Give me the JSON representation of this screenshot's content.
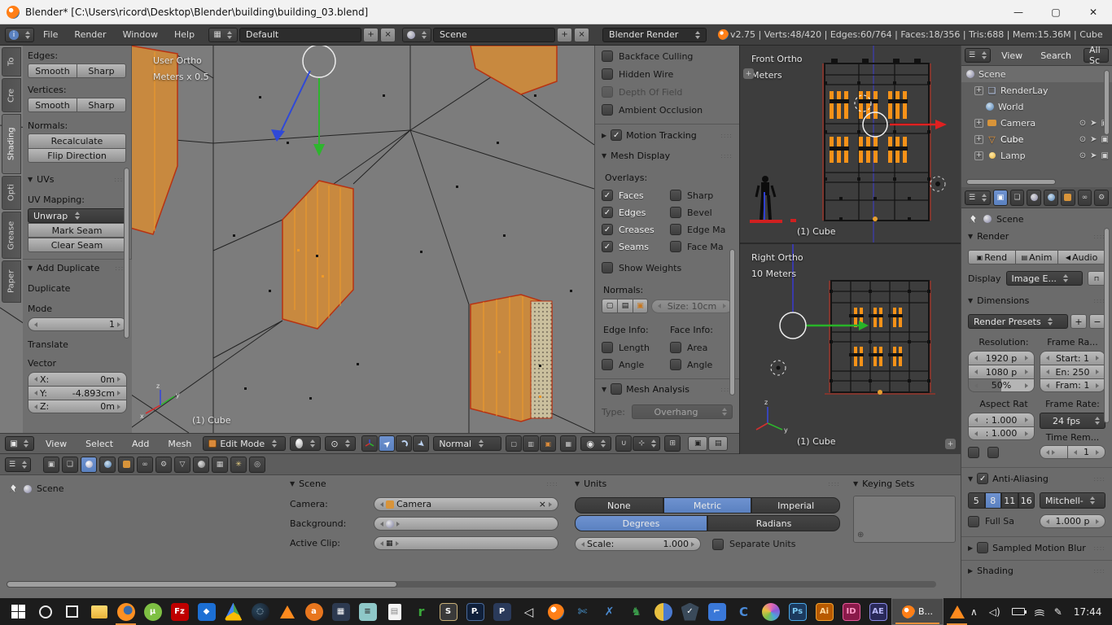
{
  "window": {
    "title": "Blender* [C:\\Users\\ricord\\Desktop\\Blender\\building\\building_03.blend]",
    "minimize": "—",
    "maximize": "▢",
    "close": "✕"
  },
  "infobar": {
    "menus": [
      "File",
      "Render",
      "Window",
      "Help"
    ],
    "layout": "Default",
    "scene": "Scene",
    "engine": "Blender Render",
    "stats": "v2.75 | Verts:48/420 | Edges:60/764 | Faces:18/356 | Tris:688 | Mem:15.36M | Cube"
  },
  "toolshelf": {
    "tabs": [
      "To",
      "Cre",
      "Shading",
      "Opti",
      "Grease",
      "Paper"
    ],
    "edges_label": "Edges:",
    "vertices_label": "Vertices:",
    "smooth": "Smooth",
    "sharp": "Sharp",
    "normals_label": "Normals:",
    "recalculate": "Recalculate",
    "flip_direction": "Flip Direction",
    "uvs_header": "UVs",
    "uv_mapping_label": "UV Mapping:",
    "unwrap": "Unwrap",
    "mark_seam": "Mark Seam",
    "clear_seam": "Clear Seam",
    "operator": {
      "header": "Add Duplicate",
      "duplicate": "Duplicate",
      "mode_label": "Mode",
      "mode_value": "1",
      "translate": "Translate",
      "vector": "Vector",
      "x_label": "X:",
      "x_value": "0m",
      "y_label": "Y:",
      "y_value": "-4.893cm",
      "z_label": "Z:",
      "z_value": "0m"
    }
  },
  "viewport": {
    "view_label": "User Ortho",
    "unit_label": "Meters x 0.5",
    "object_label": "(1) Cube"
  },
  "view_header": {
    "menus": [
      "View",
      "Select",
      "Add",
      "Mesh"
    ],
    "mode": "Edit Mode",
    "orientation": "Normal"
  },
  "npanel": {
    "backface": "Backface Culling",
    "hidden_wire": "Hidden Wire",
    "dof": "Depth Of Field",
    "ao": "Ambient Occlusion",
    "motion_tracking": "Motion Tracking",
    "mesh_display": {
      "header": "Mesh Display",
      "overlays": "Overlays:",
      "faces": "Faces",
      "edges": "Edges",
      "creases": "Creases",
      "seams": "Seams",
      "sharp": "Sharp",
      "bevel": "Bevel",
      "edge_marks": "Edge Ma",
      "face_marks": "Face Ma",
      "show_weights": "Show Weights",
      "normals_label": "Normals:",
      "size": "Size: 10cm",
      "edge_info": "Edge Info:",
      "face_info": "Face Info:",
      "length": "Length",
      "angle": "Angle",
      "area": "Area",
      "angle2": "Angle"
    },
    "mesh_analysis": {
      "header": "Mesh Analysis",
      "type_label": "Type:",
      "type_value": "Overhang"
    }
  },
  "front_view": {
    "view_label": "Front Ortho",
    "unit_label": "Meters",
    "object_label": "(1) Cube"
  },
  "right_view": {
    "view_label": "Right Ortho",
    "unit_label": "10 Meters",
    "object_label": "(1) Cube"
  },
  "outliner": {
    "menus": [
      "View",
      "Search"
    ],
    "filter": "All Sc",
    "items": [
      {
        "label": "Scene"
      },
      {
        "label": "RenderLay"
      },
      {
        "label": "World"
      },
      {
        "label": "Camera"
      },
      {
        "label": "Cube"
      },
      {
        "label": "Lamp"
      }
    ]
  },
  "properties": {
    "breadcrumb": "Scene",
    "render": {
      "header": "Render",
      "rend": "Rend",
      "anim": "Anim",
      "audio": "Audio",
      "display_label": "Display",
      "display_value": "Image E..."
    },
    "dimensions": {
      "header": "Dimensions",
      "presets": "Render Presets",
      "resolution_label": "Resolution:",
      "res_x": "1920 p",
      "res_y": "1080 p",
      "res_pct": "50%",
      "frame_range_label": "Frame Ra...",
      "start": "Start: 1",
      "end": "En: 250",
      "step": "Fram: 1",
      "aspect_label": "Aspect Rat",
      "aspect_x": ": 1.000",
      "aspect_y": ": 1.000",
      "framerate_label": "Frame Rate:",
      "fps": "24 fps",
      "time_remap_label": "Time Rem...",
      "remap": "1"
    },
    "antialiasing": {
      "header": "Anti-Aliasing",
      "s5": "5",
      "s8": "8",
      "s11": "11",
      "s16": "16",
      "filter": "Mitchell-",
      "full_sample": "Full Sa",
      "size": "1.000 p"
    },
    "sampled_motion_blur": "Sampled Motion Blur",
    "shading": "Shading"
  },
  "bottom": {
    "breadcrumb": "Scene",
    "scene_panel": {
      "header": "Scene",
      "camera_label": "Camera:",
      "camera_value": "Camera",
      "background_label": "Background:",
      "active_clip_label": "Active Clip:"
    },
    "units": {
      "header": "Units",
      "none": "None",
      "metric": "Metric",
      "imperial": "Imperial",
      "degrees": "Degrees",
      "radians": "Radians",
      "scale_label": "Scale:",
      "scale_value": "1.000",
      "separate": "Separate Units"
    },
    "keying": {
      "header": "Keying Sets"
    }
  },
  "taskbar": {
    "time": "17:44",
    "blender_task": "B...",
    "letters": {
      "fz": "Fz",
      "s": "S",
      "p1": "P.",
      "p2": "P",
      "ps": "Ps",
      "ai": "Ai",
      "id": "ID",
      "ae": "AE",
      "c": "C"
    }
  },
  "colors": {
    "accent": "#5a81c0",
    "face_orange": "#c8893f",
    "seam_red": "#b83212",
    "select_orange": "#f09a28"
  }
}
